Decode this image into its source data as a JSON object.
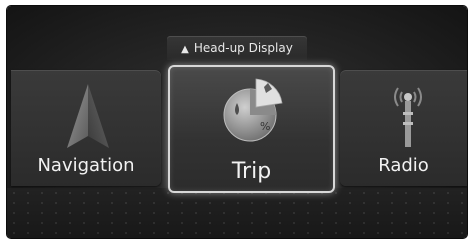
{
  "hud": {
    "label": "Head-up Display",
    "icon": "triangle-up-icon"
  },
  "menu": {
    "items": [
      {
        "label": "Navigation",
        "icon": "navigation-arrow-icon",
        "selected": false
      },
      {
        "label": "Trip",
        "icon": "trip-pie-icon",
        "selected": true,
        "badge": "%"
      },
      {
        "label": "Radio",
        "icon": "radio-antenna-icon",
        "selected": false
      }
    ]
  },
  "colors": {
    "background": "#262626",
    "highlight": "#d8d8d8",
    "text": "#f2f2f2"
  }
}
